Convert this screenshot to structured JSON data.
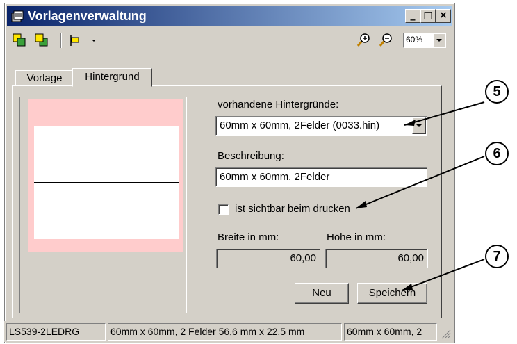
{
  "window": {
    "title": "Vorlagenverwaltung",
    "minimize_label": "_",
    "maximize_label": "□",
    "close_label": "×"
  },
  "toolbar": {
    "zoom_value": "60%"
  },
  "tabs": [
    {
      "label": "Vorlage",
      "active": false
    },
    {
      "label": "Hintergrund",
      "active": true
    }
  ],
  "form": {
    "backgrounds_label": "vorhandene Hintergründe:",
    "backgrounds_selected": "60mm x 60mm, 2Felder  (0033.hin)",
    "description_label": "Beschreibung:",
    "description_value": "60mm x 60mm, 2Felder",
    "print_visible_label": "ist sichtbar beim drucken",
    "print_visible_checked": false,
    "width_label": "Breite in mm:",
    "width_value": "60,00",
    "height_label": "Höhe in mm:",
    "height_value": "60,00",
    "new_button": {
      "prefix": "",
      "accel": "N",
      "rest": "eu"
    },
    "save_button": {
      "prefix": "",
      "accel": "S",
      "rest": "peichern"
    }
  },
  "statusbar": {
    "cells": [
      "LS539-2LEDRG",
      "60mm x 60mm, 2 Felder 56,6 mm x 22,5 mm",
      "60mm x 60mm, 2"
    ]
  },
  "callouts": [
    "5",
    "6",
    "7"
  ],
  "colors": {
    "titlebar_start": "#0a246a",
    "titlebar_end": "#a6caf0",
    "face": "#d4d0c8",
    "preview_pink": "#ffcccc"
  }
}
